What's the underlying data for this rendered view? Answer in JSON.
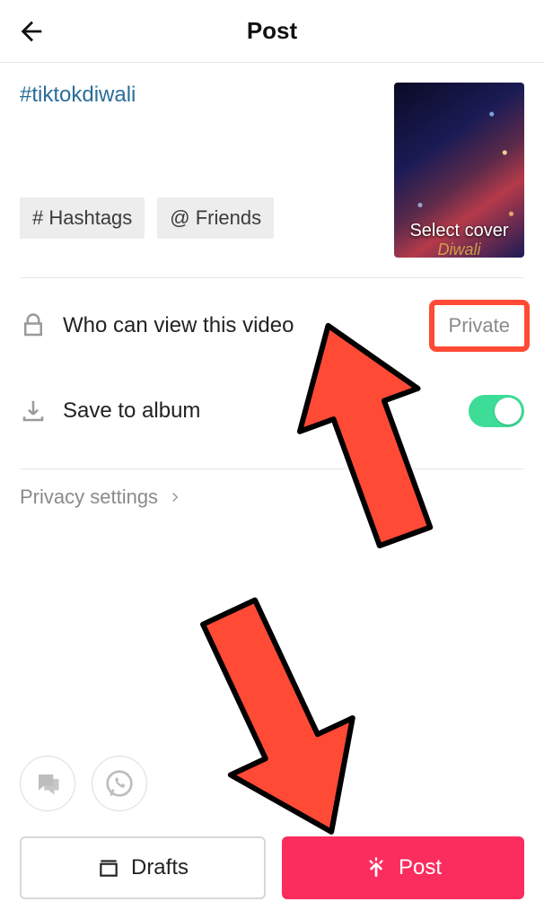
{
  "header": {
    "title": "Post"
  },
  "caption": {
    "hashtag": "#tiktokdiwali",
    "chip_hashtags": "# Hashtags",
    "chip_friends": "@ Friends",
    "cover_label": "Select cover",
    "cover_sub": "Diwali"
  },
  "settings": {
    "visibility_label": "Who can view this video",
    "visibility_value": "Private",
    "save_label": "Save to album",
    "save_toggle": true,
    "privacy_link": "Privacy settings"
  },
  "buttons": {
    "drafts": "Drafts",
    "post": "Post"
  },
  "annotations": {
    "highlight": "privacy-value",
    "arrows": [
      "privacy-value",
      "post-button"
    ]
  }
}
